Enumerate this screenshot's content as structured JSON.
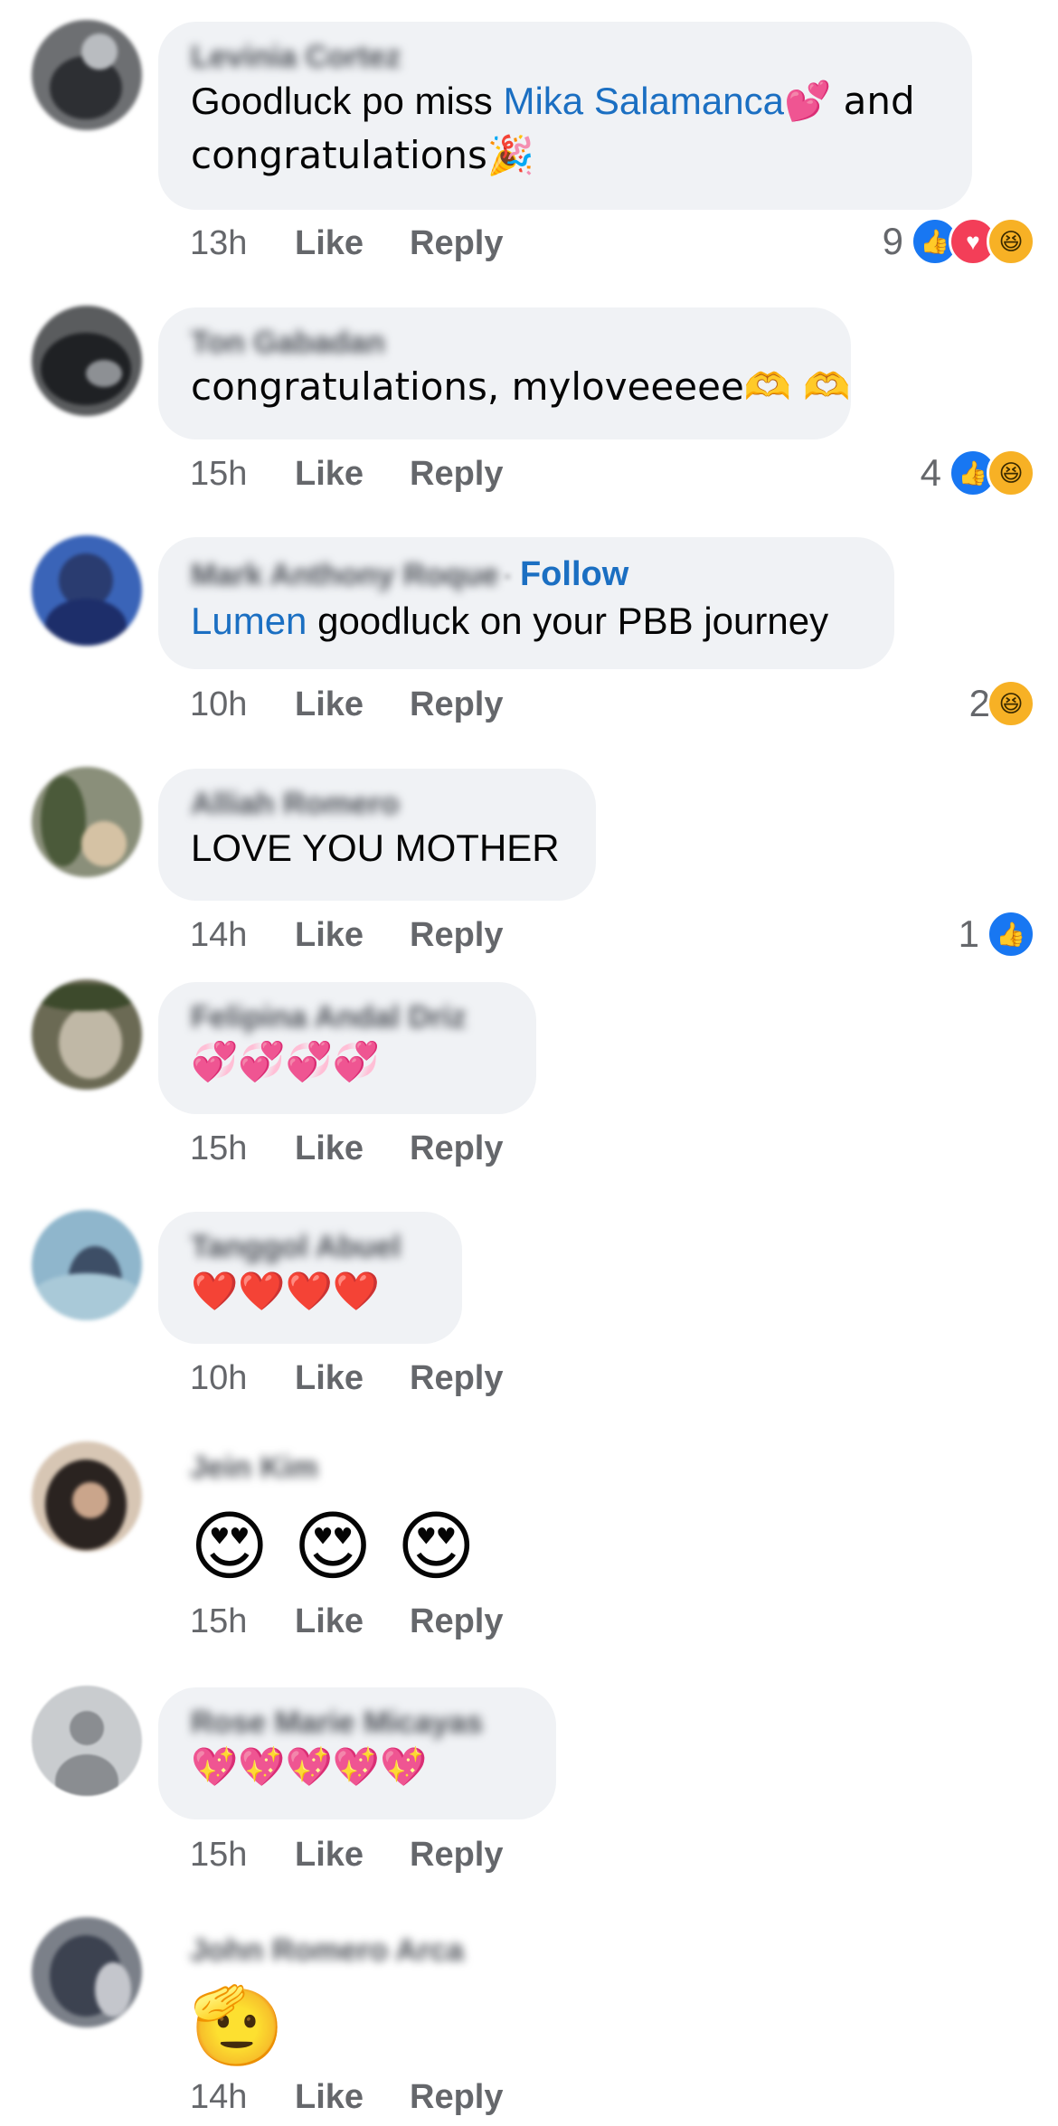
{
  "comments": [
    {
      "author": "Levinia Cortez",
      "text_pre": "Goodluck po miss ",
      "mention": "Mika Salamanca",
      "text_post": "💕 and",
      "text_line2": "congratulations🎉",
      "time": "13h",
      "like": "Like",
      "reply": "Reply",
      "reaction_count": "9",
      "reactions": [
        "like",
        "love",
        "haha"
      ]
    },
    {
      "author": "Ton Gabadan",
      "text": "congratulations, myloveeeee🫶 🫶",
      "time": "15h",
      "like": "Like",
      "reply": "Reply",
      "reaction_count": "4",
      "reactions": [
        "like",
        "haha"
      ]
    },
    {
      "author": "Mark Anthony Roque",
      "follow": "Follow",
      "mention": "Lumen",
      "text_post": " goodluck on your PBB journey",
      "time": "10h",
      "like": "Like",
      "reply": "Reply",
      "reaction_count": "2",
      "reactions": [
        "haha"
      ]
    },
    {
      "author": "Alliah Romero",
      "text": "LOVE YOU MOTHER",
      "time": "14h",
      "like": "Like",
      "reply": "Reply",
      "reaction_count": "1",
      "reactions": [
        "like"
      ]
    },
    {
      "author": "Felipina Andal Driz",
      "text": "💞💞💞💞",
      "time": "15h",
      "like": "Like",
      "reply": "Reply"
    },
    {
      "author": "Tanggol Abuel",
      "text": "❤️❤️❤️❤️",
      "time": "10h",
      "like": "Like",
      "reply": "Reply"
    },
    {
      "author": "Jein Kim",
      "text": "😍 😍 😍",
      "time": "15h",
      "like": "Like",
      "reply": "Reply"
    },
    {
      "author": "Rose Marie Micayas",
      "text": "💖💖💖💖💖",
      "time": "15h",
      "like": "Like",
      "reply": "Reply"
    },
    {
      "author": "John Romero Arca",
      "text": "🫡",
      "time": "14h",
      "like": "Like",
      "reply": "Reply"
    }
  ],
  "colors": {
    "bubble": "#f0f2f5",
    "link": "#1b6fc2",
    "meta": "#65676b",
    "like_reaction": "#1877f2",
    "love_reaction": "#f33e58",
    "haha_reaction": "#f7b125"
  }
}
